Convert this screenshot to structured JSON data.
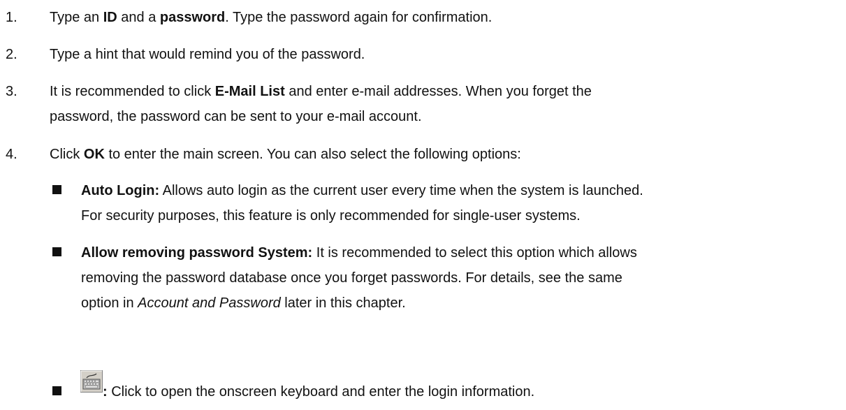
{
  "steps": [
    {
      "num": "1.",
      "parts": {
        "a": "Type an ",
        "b": "ID",
        "c": " and a ",
        "d": "password",
        "e": ". Type the password again for confirmation."
      }
    },
    {
      "num": "2.",
      "text": "Type a hint that would remind you of the password."
    },
    {
      "num": "3.",
      "parts": {
        "a": "It is recommended to click ",
        "b": "E-Mail List",
        "c": " and enter e-mail addresses. When you forget the",
        "d": "password, the password can be sent to your e-mail account."
      }
    },
    {
      "num": "4.",
      "parts": {
        "a": "Click ",
        "b": "OK",
        "c": " to enter the main screen. You can also select the following options:"
      }
    }
  ],
  "options": [
    {
      "label": "Auto Login:",
      "line1": " Allows auto login as the current user every time when the system is launched.",
      "line2": "For security purposes, this feature is only recommended for single-user systems."
    },
    {
      "label": "Allow removing password System:",
      "line1": " It is recommended to select this option which allows",
      "line2": "removing the password database once you forget passwords. For details, see the same",
      "line3a": "option in ",
      "line3b": "Account and Password",
      "line3c": " later in this chapter."
    },
    {
      "label": ":",
      "text": " Click to open the onscreen keyboard and enter the login information.",
      "icon": "keyboard-icon"
    }
  ]
}
